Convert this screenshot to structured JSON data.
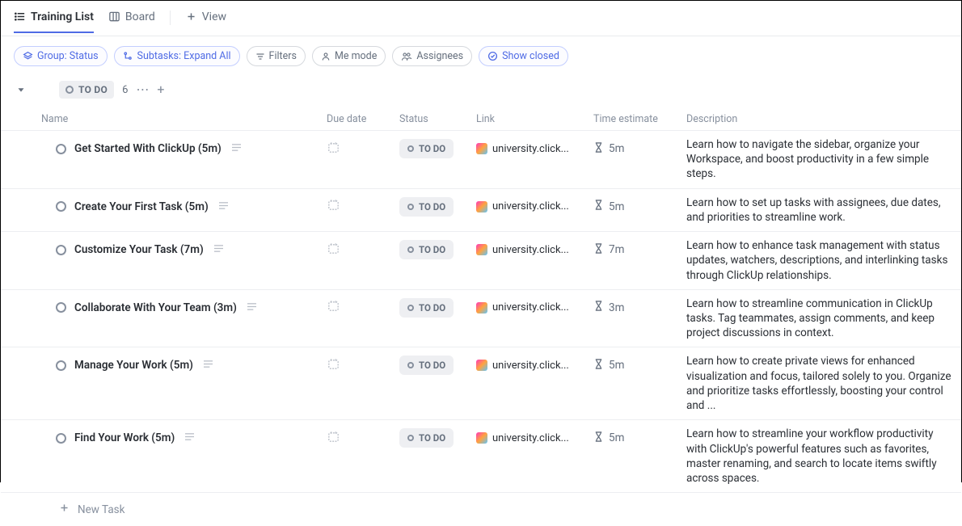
{
  "tabs": {
    "list": "Training List",
    "board": "Board",
    "view": "View"
  },
  "toolbar": {
    "group": "Group: Status",
    "subtasks": "Subtasks: Expand All",
    "filters": "Filters",
    "me_mode": "Me mode",
    "assignees": "Assignees",
    "show_closed": "Show closed"
  },
  "group": {
    "status_label": "TO DO",
    "count": "6"
  },
  "columns": {
    "name": "Name",
    "due_date": "Due date",
    "status": "Status",
    "link": "Link",
    "time_estimate": "Time estimate",
    "description": "Description"
  },
  "status_pill": "TO DO",
  "link_text": "university.click...",
  "tasks": [
    {
      "name": "Get Started With ClickUp (5m)",
      "estimate": "5m",
      "description": "Learn how to navigate the sidebar, organize your Workspace, and boost productivity in a few simple steps."
    },
    {
      "name": "Create Your First Task (5m)",
      "estimate": "5m",
      "description": "Learn how to set up tasks with assignees, due dates, and priorities to streamline work."
    },
    {
      "name": "Customize Your Task (7m)",
      "estimate": "7m",
      "description": "Learn how to enhance task management with status up­dates, watchers, descriptions, and interlinking tasks through ClickUp relationships."
    },
    {
      "name": "Collaborate With Your Team (3m)",
      "estimate": "3m",
      "description": "Learn how to streamline communication in ClickUp tasks. Tag teammates, assign comments, and keep project dis­cussions in context."
    },
    {
      "name": "Manage Your Work (5m)",
      "estimate": "5m",
      "description": "Learn how to create private views for enhanced visualiza­tion and focus, tailored solely to you. Organize and priori­tize tasks effortlessly, boosting your control and ..."
    },
    {
      "name": "Find Your Work (5m)",
      "estimate": "5m",
      "description": "Learn how to streamline your workflow productivity with ClickUp's powerful features such as favorites, master re­naming, and search to locate items swiftly across spaces."
    }
  ],
  "new_task": "New Task"
}
